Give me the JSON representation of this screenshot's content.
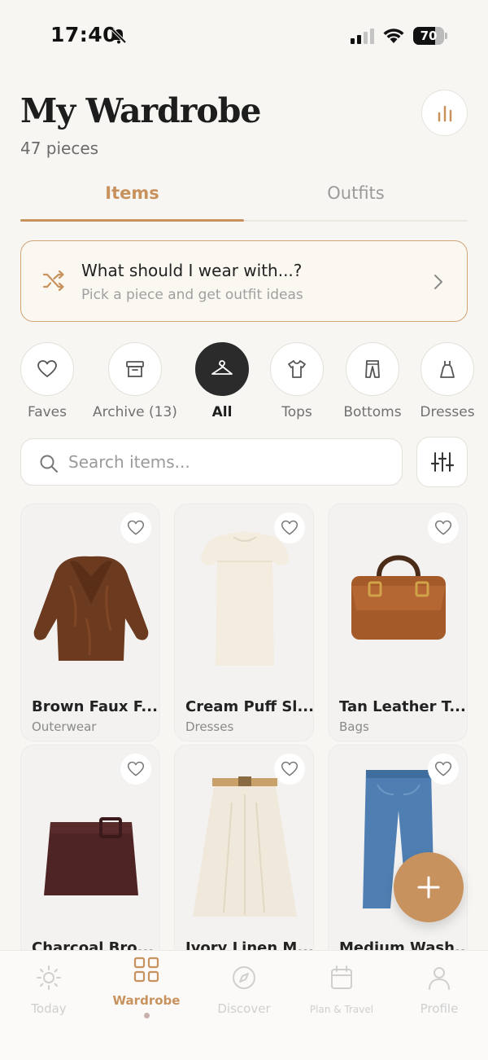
{
  "status_bar": {
    "time": "17:40",
    "battery": "70",
    "battery_level": 0.7
  },
  "header": {
    "title": "My Wardrobe",
    "count": "47 pieces"
  },
  "tabs": [
    {
      "label": "Items"
    },
    {
      "label": "Outfits"
    }
  ],
  "suggestion": {
    "title": "What should I wear with...?",
    "subtitle": "Pick a piece and get outfit ideas"
  },
  "categories": [
    {
      "label": "Faves",
      "icon": "heart-icon"
    },
    {
      "label": "Archive (13)",
      "icon": "archive-box-icon"
    },
    {
      "label": "All",
      "icon": "hanger-icon"
    },
    {
      "label": "Tops",
      "icon": "tshirt-icon"
    },
    {
      "label": "Bottoms",
      "icon": "pants-icon"
    },
    {
      "label": "Dresses",
      "icon": "dress-icon"
    }
  ],
  "search": {
    "placeholder": "Search items..."
  },
  "items": [
    {
      "name": "Brown Faux F...",
      "category": "Outerwear"
    },
    {
      "name": "Cream Puff Sl...",
      "category": "Dresses"
    },
    {
      "name": "Tan Leather T...",
      "category": "Bags"
    },
    {
      "name": "Charcoal Bro...",
      "category": ""
    },
    {
      "name": "Ivory Linen M...",
      "category": ""
    },
    {
      "name": "Medium Wash...",
      "category": ""
    }
  ],
  "nav": [
    {
      "label": "Today",
      "icon": "sun-icon"
    },
    {
      "label": "Wardrobe",
      "icon": "grid-icon"
    },
    {
      "label": "Discover",
      "icon": "compass-icon"
    },
    {
      "label": "Plan & Travel",
      "icon": "calendar-icon"
    },
    {
      "label": "Profile",
      "icon": "user-icon"
    }
  ],
  "colors": {
    "accent": "#c8925e",
    "background": "#f8f6f2",
    "active_chip": "#2b2b2b"
  }
}
